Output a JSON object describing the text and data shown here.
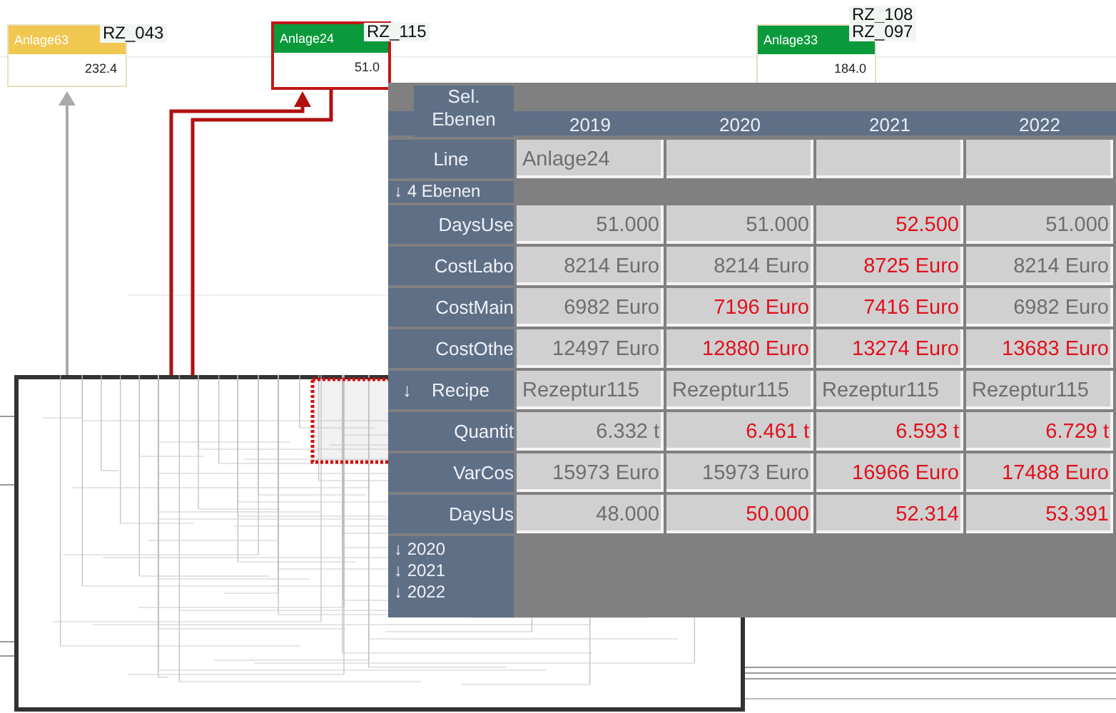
{
  "nodes": [
    {
      "title": "Anlage63",
      "value": "232.4",
      "color": "#f0c850",
      "selected": false,
      "tags": [
        "RZ_043"
      ]
    },
    {
      "title": "Anlage24",
      "value": "51.0",
      "color": "#0a9a3c",
      "selected": true,
      "tags": [
        "RZ_115"
      ]
    },
    {
      "title": "Anlage33",
      "value": "184.0",
      "color": "#0a9a3c",
      "selected": false,
      "tags": [
        "RZ_108",
        "RZ_097"
      ]
    }
  ],
  "panel": {
    "header_label": "Sel. Ebenen",
    "years": [
      "2019",
      "2020",
      "2021",
      "2022"
    ],
    "line": {
      "label": "Line",
      "value": "Anlage24"
    },
    "section": "↓ 4 Ebenen",
    "rows": [
      {
        "kind": "metric",
        "label": "DaysUse",
        "cells": [
          {
            "text": "51.000",
            "changed": false
          },
          {
            "text": "51.000",
            "changed": false
          },
          {
            "text": "52.500",
            "changed": true
          },
          {
            "text": "51.000",
            "changed": false
          }
        ]
      },
      {
        "kind": "metric",
        "label": "CostLabo",
        "cells": [
          {
            "text": "8214 Euro",
            "changed": false
          },
          {
            "text": "8214 Euro",
            "changed": false
          },
          {
            "text": "8725 Euro",
            "changed": true
          },
          {
            "text": "8214 Euro",
            "changed": false
          }
        ]
      },
      {
        "kind": "metric",
        "label": "CostMain",
        "cells": [
          {
            "text": "6982 Euro",
            "changed": false
          },
          {
            "text": "7196 Euro",
            "changed": true
          },
          {
            "text": "7416 Euro",
            "changed": true
          },
          {
            "text": "6982 Euro",
            "changed": false
          }
        ]
      },
      {
        "kind": "metric",
        "label": "CostOthe",
        "cells": [
          {
            "text": "12497 Euro",
            "changed": false
          },
          {
            "text": "12880 Euro",
            "changed": true
          },
          {
            "text": "13274 Euro",
            "changed": true
          },
          {
            "text": "13683 Euro",
            "changed": true
          }
        ]
      },
      {
        "kind": "group",
        "marker": "↓",
        "label": "Recipe",
        "cells": [
          {
            "text": "Rezeptur115",
            "changed": false
          },
          {
            "text": "Rezeptur115",
            "changed": false
          },
          {
            "text": "Rezeptur115",
            "changed": false
          },
          {
            "text": "Rezeptur115",
            "changed": false
          }
        ]
      },
      {
        "kind": "metric",
        "label": "Quantit",
        "cells": [
          {
            "text": "6.332 t",
            "changed": false
          },
          {
            "text": "6.461 t",
            "changed": true
          },
          {
            "text": "6.593 t",
            "changed": true
          },
          {
            "text": "6.729 t",
            "changed": true
          }
        ]
      },
      {
        "kind": "metric",
        "label": "VarCos",
        "cells": [
          {
            "text": "15973 Euro",
            "changed": false
          },
          {
            "text": "15973 Euro",
            "changed": false
          },
          {
            "text": "16966 Euro",
            "changed": true
          },
          {
            "text": "17488 Euro",
            "changed": true
          }
        ]
      },
      {
        "kind": "metric",
        "label": "DaysUs",
        "cells": [
          {
            "text": "48.000",
            "changed": false
          },
          {
            "text": "50.000",
            "changed": true
          },
          {
            "text": "52.314",
            "changed": true
          },
          {
            "text": "53.391",
            "changed": true
          }
        ]
      }
    ],
    "footer": [
      "↓ 2020",
      "↓ 2021",
      "↓ 2022"
    ]
  }
}
